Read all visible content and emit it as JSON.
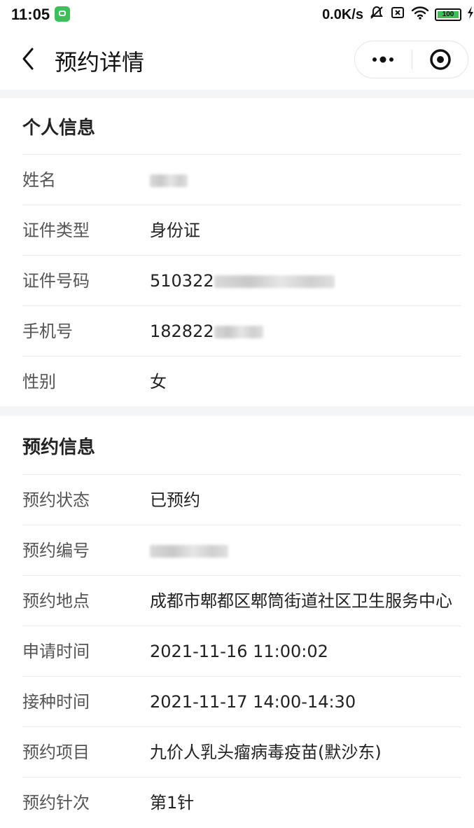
{
  "status_bar": {
    "time": "11:05",
    "net_speed": "0.0K/s",
    "battery": "100"
  },
  "nav": {
    "title": "预约详情"
  },
  "personal": {
    "title": "个人信息",
    "rows": [
      {
        "label": "姓名",
        "value": ""
      },
      {
        "label": "证件类型",
        "value": "身份证"
      },
      {
        "label": "证件号码",
        "value": "510322"
      },
      {
        "label": "手机号",
        "value": "182822"
      },
      {
        "label": "性别",
        "value": "女"
      }
    ]
  },
  "appointment": {
    "title": "预约信息",
    "rows": [
      {
        "label": "预约状态",
        "value": "已预约"
      },
      {
        "label": "预约编号",
        "value": ""
      },
      {
        "label": "预约地点",
        "value": "成都市郫都区郫筒街道社区卫生服务中心"
      },
      {
        "label": "申请时间",
        "value": "2021-11-16 11:00:02"
      },
      {
        "label": "接种时间",
        "value": "2021-11-17 14:00-14:30"
      },
      {
        "label": "预约项目",
        "value": "九价人乳头瘤病毒疫苗(默沙东)"
      },
      {
        "label": "预约针次",
        "value": "第1针"
      }
    ]
  }
}
